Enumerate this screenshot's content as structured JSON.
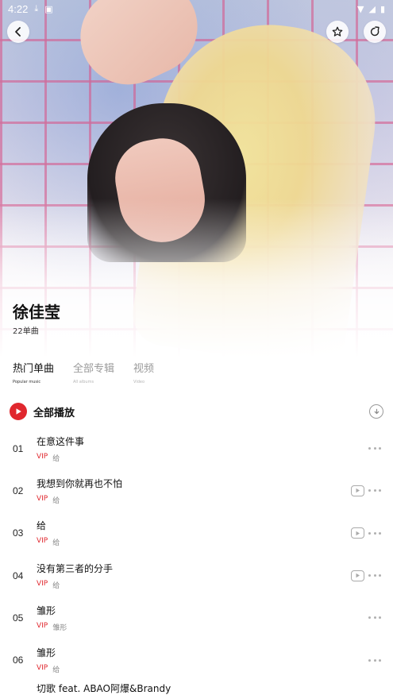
{
  "status_bar": {
    "time": "4:22"
  },
  "artist": {
    "name": "徐佳莹",
    "song_count": "22单曲"
  },
  "tabs": [
    {
      "label": "热门单曲",
      "sub": "Popular music",
      "active": true
    },
    {
      "label": "全部专辑",
      "sub": "All albums",
      "active": false
    },
    {
      "label": "视频",
      "sub": "Video",
      "active": false
    }
  ],
  "play_all": {
    "label": "全部播放"
  },
  "songs": [
    {
      "index": "01",
      "title": "在意这件事",
      "vip": "VIP",
      "album": "给",
      "has_mv": false
    },
    {
      "index": "02",
      "title": "我想到你就再也不怕",
      "vip": "VIP",
      "album": "给",
      "has_mv": true
    },
    {
      "index": "03",
      "title": "给",
      "vip": "VIP",
      "album": "给",
      "has_mv": true
    },
    {
      "index": "04",
      "title": "没有第三者的分手",
      "vip": "VIP",
      "album": "给",
      "has_mv": true
    },
    {
      "index": "05",
      "title": "雏形",
      "vip": "VIP",
      "album": "雏形",
      "has_mv": false
    },
    {
      "index": "06",
      "title": "雏形",
      "vip": "VIP",
      "album": "给",
      "has_mv": false
    },
    {
      "index": "",
      "title": "切歌 feat. ABAO阿爆&Brandy",
      "vip": "",
      "album": "",
      "has_mv": false
    }
  ],
  "colors": {
    "accent": "#e0272e",
    "muted": "#888888"
  },
  "icons": {
    "back": "chevron-left-icon",
    "favorite": "star-icon",
    "share": "share-icon",
    "play": "play-icon",
    "download": "download-icon",
    "mv": "video-icon",
    "more": "more-dots-icon"
  }
}
